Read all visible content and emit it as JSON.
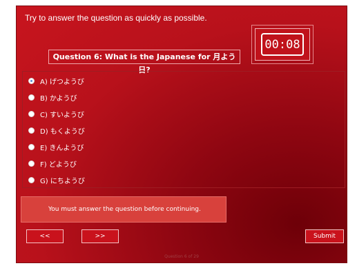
{
  "instruction": "Try to answer the question as quickly as possible.",
  "timer": "00:08",
  "question": "Question 6: What is the Japanese for 月よう日?",
  "options": [
    {
      "label": "A) げつようび",
      "selected": true
    },
    {
      "label": "B) かようび",
      "selected": false
    },
    {
      "label": "C) すいようび",
      "selected": false
    },
    {
      "label": "D) もくようび",
      "selected": false
    },
    {
      "label": "E) きんようび",
      "selected": false
    },
    {
      "label": "F) どようび",
      "selected": false
    },
    {
      "label": "G) にちようび",
      "selected": false
    }
  ],
  "error_message": "You must answer the question before continuing.",
  "nav": {
    "prev_label": "<<",
    "next_label": ">>",
    "submit_label": "Submit"
  },
  "page_indicator": "Question 6 of 29"
}
